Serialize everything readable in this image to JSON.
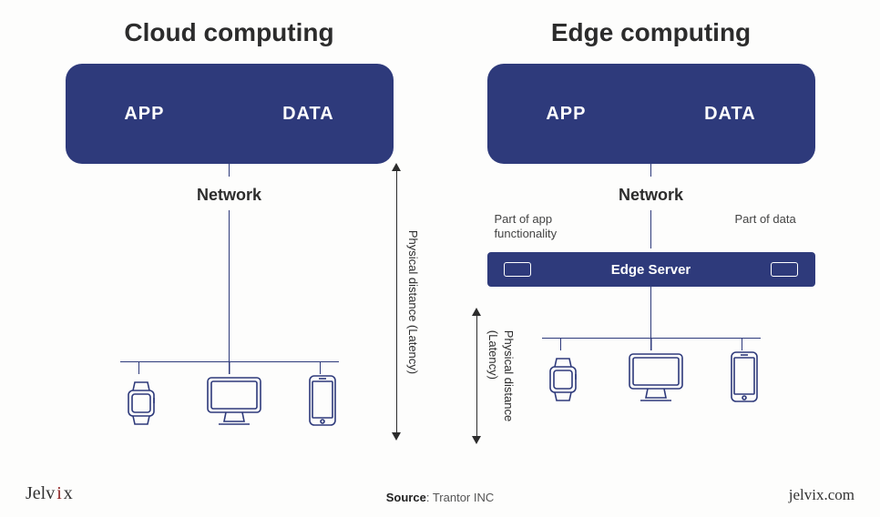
{
  "cloud": {
    "title": "Cloud computing",
    "box": {
      "app": "APP",
      "data": "DATA"
    },
    "network": "Network",
    "latency": "Physical distance (Latency)"
  },
  "edge": {
    "title": "Edge computing",
    "box": {
      "app": "APP",
      "data": "DATA"
    },
    "network": "Network",
    "sub_left": "Part of app functionality",
    "sub_right": "Part of data",
    "server": "Edge Server",
    "latency": "Physical distance\n(Latency)"
  },
  "footer": {
    "brand": "Jelvix",
    "source_label": "Source",
    "source_value": "Trantor INC",
    "site": "jelvix.com"
  }
}
